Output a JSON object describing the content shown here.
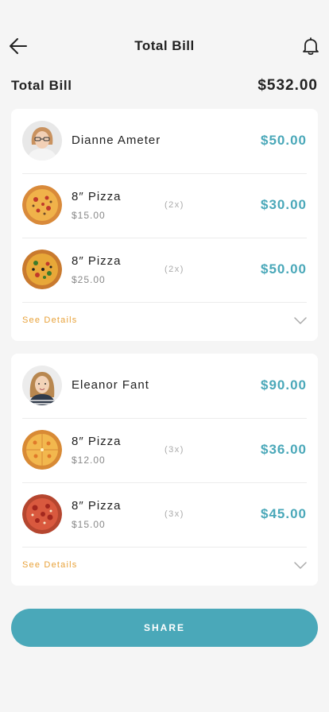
{
  "header": {
    "title": "Total Bill"
  },
  "summary": {
    "label": "Total Bill",
    "value": "$532.00"
  },
  "cards": [
    {
      "person": {
        "name": "Dianne Ameter",
        "amount": "$50.00"
      },
      "items": [
        {
          "name": "8″ Pizza",
          "price": "$15.00",
          "qty": "(2x)",
          "amount": "$30.00"
        },
        {
          "name": "8″ Pizza",
          "price": "$25.00",
          "qty": "(2x)",
          "amount": "$50.00"
        }
      ],
      "details_label": "See Details"
    },
    {
      "person": {
        "name": "Eleanor Fant",
        "amount": "$90.00"
      },
      "items": [
        {
          "name": "8″ Pizza",
          "price": "$12.00",
          "qty": "(3x)",
          "amount": "$36.00"
        },
        {
          "name": "8″ Pizza",
          "price": "$15.00",
          "qty": "(3x)",
          "amount": "$45.00"
        }
      ],
      "details_label": "See Details"
    }
  ],
  "share_label": "SHARE",
  "colors": {
    "accent": "#4aa8b9",
    "link": "#e8a23a",
    "background": "#f5f5f5"
  },
  "icons": {
    "back": "arrow-left-icon",
    "notifications": "bell-icon",
    "expand": "chevron-down-icon"
  }
}
